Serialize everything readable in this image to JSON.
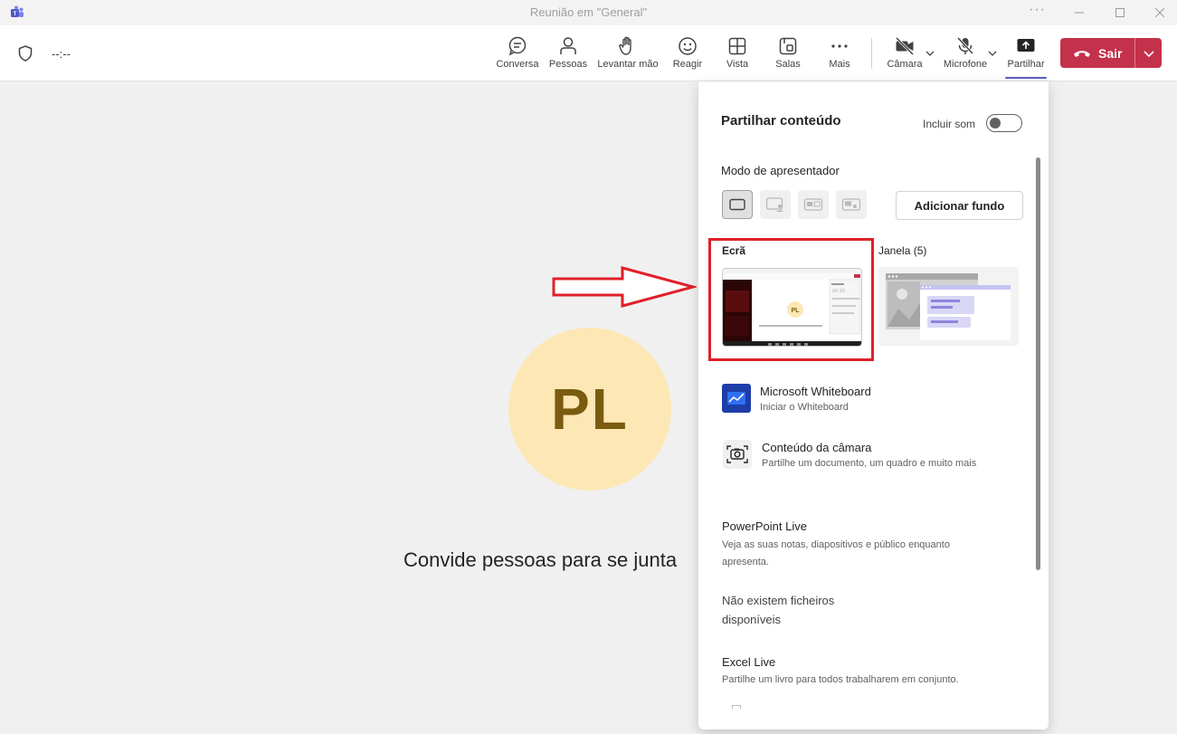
{
  "window": {
    "title": "Reunião em \"General\""
  },
  "toolbar": {
    "timer": "--:--",
    "buttons": {
      "chat": "Conversa",
      "people": "Pessoas",
      "raise_hand": "Levantar mão",
      "react": "Reagir",
      "view": "Vista",
      "rooms": "Salas",
      "more": "Mais",
      "camera": "Câmara",
      "mic": "Microfone",
      "share": "Partilhar"
    },
    "leave_label": "Sair"
  },
  "stage": {
    "avatar_initials": "PL",
    "invite_text": "Convide pessoas para se junta"
  },
  "share_panel": {
    "title": "Partilhar conteúdo",
    "include_sound_label": "Incluir som",
    "include_sound_on": false,
    "presenter_mode_label": "Modo de apresentador",
    "add_background_label": "Adicionar fundo",
    "screen_label": "Ecrã",
    "screen_thumb_initials": "PL",
    "window_label": "Janela (5)",
    "whiteboard": {
      "title": "Microsoft Whiteboard",
      "subtitle": "Iniciar o Whiteboard"
    },
    "camera_content": {
      "title": "Conteúdo da câmara",
      "subtitle": "Partilhe um documento, um quadro e muito mais"
    },
    "powerpoint": {
      "title": "PowerPoint Live",
      "description_line1": "Veja as suas notas, diapositivos e público enquanto",
      "description_line2": "apresenta."
    },
    "no_files_line1": "Não existem ficheiros",
    "no_files_line2": "disponíveis",
    "excel": {
      "title": "Excel Live",
      "description": "Partilhe um livro para todos trabalharem em conjunto."
    }
  },
  "colors": {
    "leave_red": "#c4314b",
    "accent": "#5b5fc7",
    "avatar_bg": "#fde7b5",
    "avatar_text": "#7a5b0f",
    "highlight_red": "#e0202a"
  }
}
